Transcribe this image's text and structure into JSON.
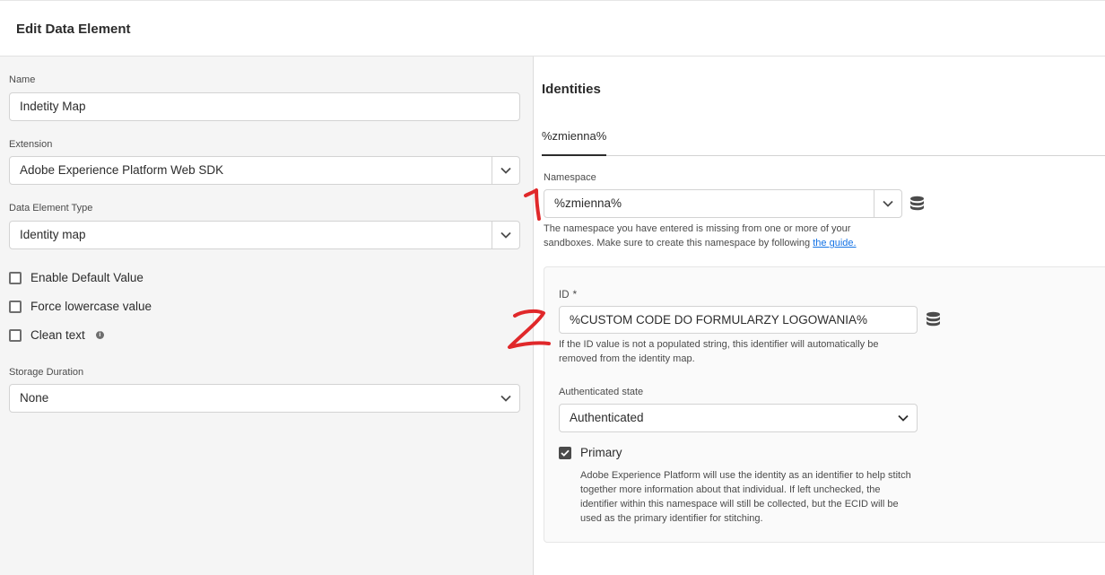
{
  "header": {
    "title": "Edit Data Element"
  },
  "left": {
    "name_label": "Name",
    "name_value": "Indetity Map",
    "extension_label": "Extension",
    "extension_value": "Adobe Experience Platform Web SDK",
    "type_label": "Data Element Type",
    "type_value": "Identity map",
    "checkboxes": [
      {
        "label": "Enable Default Value",
        "checked": false
      },
      {
        "label": "Force lowercase value",
        "checked": false
      },
      {
        "label": "Clean text",
        "checked": false
      }
    ],
    "storage_label": "Storage Duration",
    "storage_value": "None"
  },
  "right": {
    "title": "Identities",
    "tab_label": "%zmienna%",
    "namespace_label": "Namespace",
    "namespace_value": "%zmienna%",
    "namespace_help_1": "The namespace you have entered is missing from one or more of your",
    "namespace_help_2": "sandboxes. Make sure to create this namespace by following",
    "namespace_help_link": "the guide.",
    "id_label": "ID",
    "id_required": "*",
    "id_value": "%CUSTOM CODE DO FORMULARZY LOGOWANIA%",
    "id_help_1": "If the ID value is not a populated string, this identifier will automatically be",
    "id_help_2": "removed from the identity map.",
    "auth_label": "Authenticated state",
    "auth_value": "Authenticated",
    "primary_label": "Primary",
    "primary_checked": true,
    "primary_desc": [
      "Adobe Experience Platform will use the identity as an identifier to help stitch",
      "together more information about that individual. If left unchecked, the",
      "identifier within this namespace will still be collected, but the ECID will be",
      "used as the primary identifier for stitching."
    ]
  },
  "annotations": {
    "color": "#e0282a",
    "marks": [
      "1",
      "2"
    ]
  },
  "icons": {
    "chevron": "chevron-down-icon",
    "database": "database-icon",
    "info": "info-icon",
    "check": "checkmark-icon"
  }
}
